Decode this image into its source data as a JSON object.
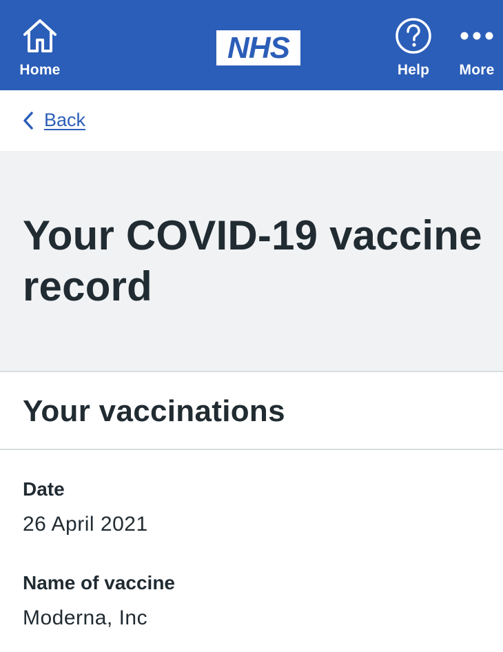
{
  "header": {
    "home_label": "Home",
    "logo_text": "NHS",
    "help_label": "Help",
    "more_label": "More",
    "background_color": "#2b5eb8"
  },
  "navigation": {
    "back_label": "Back"
  },
  "page": {
    "title": "Your COVID-19 vaccine record"
  },
  "vaccinations": {
    "heading": "Your vaccinations",
    "date_label": "Date",
    "date_value": "26 April 2021",
    "vaccine_label": "Name of vaccine",
    "vaccine_value": "Moderna, Inc"
  },
  "icons": {
    "home": "home-icon",
    "help": "help-circle-icon",
    "more": "more-dots-icon",
    "back": "chevron-left-icon"
  }
}
